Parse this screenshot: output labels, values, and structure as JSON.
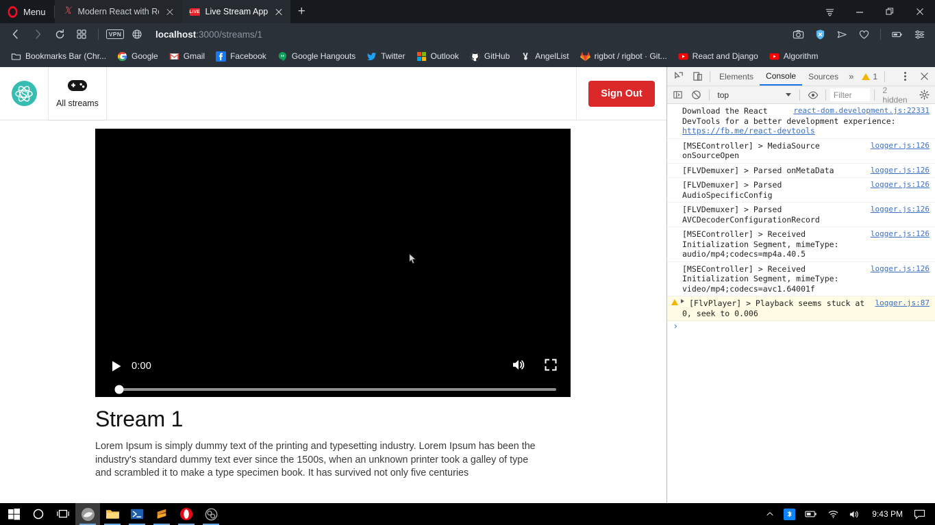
{
  "browser": {
    "name": "Opera",
    "menu_label": "Menu",
    "tabs": [
      {
        "title": "Modern React with Redux [",
        "favicon": "udemy-icon",
        "active": false
      },
      {
        "title": "Live Stream App",
        "favicon": "live-badge-icon",
        "active": true
      }
    ],
    "new_tab_label": "+",
    "window_controls": [
      "tab-menu-icon",
      "minimize-icon",
      "restore-icon",
      "close-icon"
    ],
    "toolbar": {
      "back": "back-icon",
      "forward": "forward-icon",
      "reload": "reload-icon",
      "speeddial": "speed-dial-icon",
      "vpn_label": "VPN",
      "globe": "globe-icon",
      "url_host": "localhost",
      "url_path": ":3000/streams/1",
      "right_icons": [
        "snapshot-icon",
        "ad-block-shield-icon",
        "send-icon",
        "heart-icon",
        "battery-saver-icon",
        "easy-setup-icon"
      ]
    },
    "bookmarks": [
      {
        "label": "Bookmarks Bar (Chr...",
        "icon": "folder-icon"
      },
      {
        "label": "Google",
        "icon": "google-icon"
      },
      {
        "label": "Gmail",
        "icon": "gmail-icon"
      },
      {
        "label": "Facebook",
        "icon": "facebook-icon"
      },
      {
        "label": "Google Hangouts",
        "icon": "hangouts-icon"
      },
      {
        "label": "Twitter",
        "icon": "twitter-icon"
      },
      {
        "label": "Outlook",
        "icon": "outlook-icon"
      },
      {
        "label": "GitHub",
        "icon": "github-icon"
      },
      {
        "label": "AngelList",
        "icon": "angellist-icon"
      },
      {
        "label": "rigbot / rigbot · Git...",
        "icon": "gitlab-icon"
      },
      {
        "label": "React and Django",
        "icon": "youtube-icon"
      },
      {
        "label": "Algorithm",
        "icon": "youtube-icon"
      }
    ]
  },
  "app": {
    "logo": "streamy-atom-logo",
    "nav": {
      "all_streams_label": "All streams",
      "all_streams_icon": "gamepad-icon"
    },
    "sign_out_label": "Sign Out",
    "accent_color": "#db2828",
    "logo_color": "#35bdb2",
    "player": {
      "time_label": "0:00",
      "play_icon": "play-icon",
      "volume_icon": "volume-icon",
      "fullscreen_icon": "fullscreen-icon",
      "progress_percent": 0
    },
    "stream": {
      "title": "Stream 1",
      "description": "Lorem Ipsum is simply dummy text of the printing and typesetting industry. Lorem Ipsum has been the industry's standard dummy text ever since the 1500s, when an unknown printer took a galley of type and scrambled it to make a type specimen book. It has survived not only five centuries"
    }
  },
  "devtools": {
    "tabs": [
      "Elements",
      "Console",
      "Sources"
    ],
    "active_tab": "Console",
    "more_label": "»",
    "warning_count": "1",
    "inspect_icon": "inspect-icon",
    "device_icon": "device-toolbar-icon",
    "kebab_icon": "more-options-icon",
    "close_icon": "close-icon",
    "filterbar": {
      "sidebar_icon": "console-sidebar-icon",
      "clear_icon": "clear-console-icon",
      "context": "top",
      "eye_icon": "live-expression-icon",
      "filter_placeholder": "Filter",
      "hidden_label": "2 hidden",
      "settings_icon": "settings-gear-icon"
    },
    "messages": [
      {
        "type": "info",
        "prefix": "",
        "text": "Download the React DevTools for a better development experience: ",
        "link": "https://fb.me/react-devtools",
        "source": "react-dom.development.js:22331",
        "source_above": true
      },
      {
        "type": "log",
        "text": "[MSEController] > MediaSource onSourceOpen",
        "source": "logger.js:126"
      },
      {
        "type": "log",
        "text": "[FLVDemuxer] > Parsed onMetaData",
        "source": "logger.js:126"
      },
      {
        "type": "log",
        "text": "[FLVDemuxer] > Parsed AudioSpecificConfig",
        "source": "logger.js:126"
      },
      {
        "type": "log",
        "text": "[FLVDemuxer] > Parsed AVCDecoderConfigurationRecord",
        "source": "logger.js:126"
      },
      {
        "type": "log",
        "text": "[MSEController] > Received Initialization Segment, mimeType: audio/mp4;codecs=mp4a.40.5",
        "source": "logger.js:126"
      },
      {
        "type": "log",
        "text": "[MSEController] > Received Initialization Segment, mimeType: video/mp4;codecs=avc1.64001f",
        "source": "logger.js:126"
      },
      {
        "type": "warn",
        "text": "[FlvPlayer] > Playback seems stuck at 0, seek to 0.006",
        "source": "logger.js:87"
      }
    ]
  },
  "taskbar": {
    "items": [
      {
        "name": "start-button",
        "icon": "windows-logo-icon"
      },
      {
        "name": "cortana-search",
        "icon": "circle-icon"
      },
      {
        "name": "task-view",
        "icon": "task-view-icon"
      },
      {
        "name": "opera-gx-app",
        "icon": "opera-gx-icon"
      },
      {
        "name": "file-explorer",
        "icon": "folder-icon"
      },
      {
        "name": "powershell",
        "icon": "powershell-icon"
      },
      {
        "name": "sublime-text",
        "icon": "sublime-icon"
      },
      {
        "name": "opera-browser",
        "icon": "opera-icon"
      },
      {
        "name": "obs-studio",
        "icon": "obs-icon"
      }
    ],
    "tray": {
      "expand_icon": "chevron-up-icon",
      "bluetooth_icon": "bluetooth-icon",
      "battery_icon": "battery-icon",
      "wifi_icon": "wifi-icon",
      "volume_icon": "volume-icon",
      "time": "9:43 PM",
      "action_center_icon": "action-center-icon"
    }
  }
}
